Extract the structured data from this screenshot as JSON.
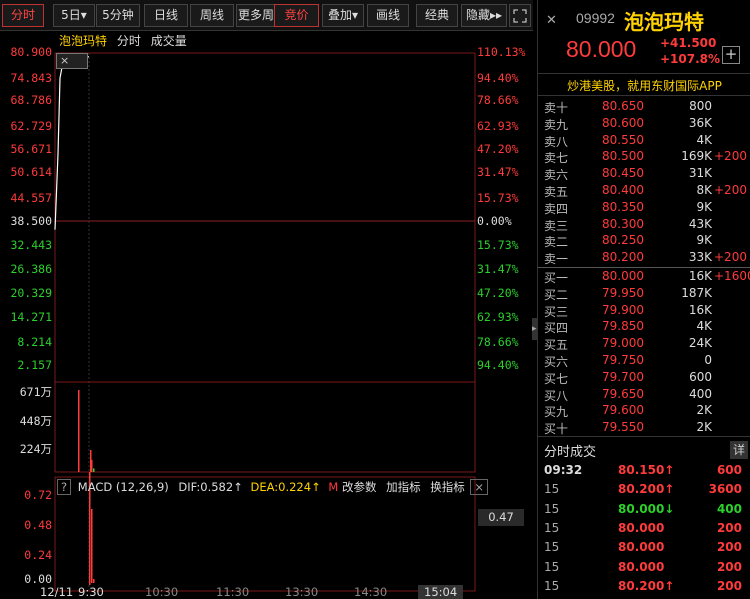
{
  "toolbar": {
    "buttons": [
      {
        "label": "分时",
        "active": true
      },
      {
        "label": "5日▾",
        "active": false
      },
      {
        "label": "5分钟",
        "active": false
      },
      {
        "label": "日线",
        "active": false
      },
      {
        "label": "周线",
        "active": false
      },
      {
        "label": "更多周",
        "active": false
      },
      {
        "label": "竞价",
        "active": true
      },
      {
        "label": "叠加▾",
        "active": false
      },
      {
        "label": "画线",
        "active": false
      },
      {
        "label": "经典",
        "active": false
      },
      {
        "label": "隐藏▸▸",
        "active": false
      }
    ],
    "fullscreen_icon": "expand-icon"
  },
  "chart_header": {
    "name": "泡泡玛特",
    "mode": "分时",
    "volume_label": "成交量"
  },
  "price_axis": {
    "left": [
      "80.900",
      "74.843",
      "68.786",
      "62.729",
      "56.671",
      "50.614",
      "44.557",
      "38.500",
      "32.443",
      "26.386",
      "20.329",
      "14.271",
      "8.214",
      "2.157"
    ],
    "right": [
      "110.13%",
      "94.40%",
      "78.66%",
      "62.93%",
      "47.20%",
      "31.47%",
      "15.73%",
      "0.00%",
      "15.73%",
      "31.47%",
      "47.20%",
      "62.93%",
      "78.66%",
      "94.40%"
    ]
  },
  "volume_axis": [
    "671万",
    "448万",
    "224万"
  ],
  "macd_header": {
    "title": "MACD (12,26,9)",
    "dif": "DIF:0.582↑",
    "dea": "DEA:0.224↑",
    "m": "M",
    "change_param": "改参数",
    "add_ind": "加指标",
    "switch_ind": "换指标"
  },
  "macd_axis": [
    "0.72",
    "0.48",
    "0.24",
    "0.00"
  ],
  "macd_value": "0.47",
  "time_axis": [
    "12/11",
    "9:30",
    "10:30",
    "11:30",
    "13:30",
    "14:30",
    "15:04"
  ],
  "chart_data": {
    "type": "line",
    "series": [
      {
        "values": [
          38.5,
          44.557,
          56.671,
          74.843,
          77.5,
          79.0,
          80.0
        ]
      }
    ],
    "volume": [
      671,
      0,
      0,
      0,
      0,
      180,
      100,
      30
    ],
    "ylim": [
      2.157,
      80.9
    ]
  },
  "quote": {
    "code": "09992",
    "name": "泡泡玛特",
    "price": "80.000",
    "change": "+41.500",
    "change_pct": "+107.8%",
    "add_icon": "plus-icon"
  },
  "ad": "炒港美股，就用东财国际APP",
  "orderbook": {
    "asks": [
      {
        "label": "卖十",
        "price": "80.650",
        "vol": "800",
        "delta": ""
      },
      {
        "label": "卖九",
        "price": "80.600",
        "vol": "36K",
        "delta": ""
      },
      {
        "label": "卖八",
        "price": "80.550",
        "vol": "4K",
        "delta": ""
      },
      {
        "label": "卖七",
        "price": "80.500",
        "vol": "169K",
        "delta": "+200"
      },
      {
        "label": "卖六",
        "price": "80.450",
        "vol": "31K",
        "delta": ""
      },
      {
        "label": "卖五",
        "price": "80.400",
        "vol": "8K",
        "delta": "+200"
      },
      {
        "label": "卖四",
        "price": "80.350",
        "vol": "9K",
        "delta": ""
      },
      {
        "label": "卖三",
        "price": "80.300",
        "vol": "43K",
        "delta": ""
      },
      {
        "label": "卖二",
        "price": "80.250",
        "vol": "9K",
        "delta": ""
      },
      {
        "label": "卖一",
        "price": "80.200",
        "vol": "33K",
        "delta": "+200"
      }
    ],
    "bids": [
      {
        "label": "买一",
        "price": "80.000",
        "vol": "16K",
        "delta": "+1600"
      },
      {
        "label": "买二",
        "price": "79.950",
        "vol": "187K",
        "delta": ""
      },
      {
        "label": "买三",
        "price": "79.900",
        "vol": "16K",
        "delta": ""
      },
      {
        "label": "买四",
        "price": "79.850",
        "vol": "4K",
        "delta": ""
      },
      {
        "label": "买五",
        "price": "79.000",
        "vol": "24K",
        "delta": ""
      },
      {
        "label": "买六",
        "price": "79.750",
        "vol": "0",
        "delta": ""
      },
      {
        "label": "买七",
        "price": "79.700",
        "vol": "600",
        "delta": ""
      },
      {
        "label": "买八",
        "price": "79.650",
        "vol": "400",
        "delta": ""
      },
      {
        "label": "买九",
        "price": "79.600",
        "vol": "2K",
        "delta": ""
      },
      {
        "label": "买十",
        "price": "79.550",
        "vol": "2K",
        "delta": ""
      }
    ]
  },
  "trades": {
    "title": "分时成交",
    "detail_button": "详",
    "rows": [
      {
        "time": "09:32",
        "price": "80.150↑",
        "vol": "600",
        "dir": "up"
      },
      {
        "time": "15",
        "price": "80.200↑",
        "vol": "3600",
        "dir": "up"
      },
      {
        "time": "15",
        "price": "80.000↓",
        "vol": "400",
        "dir": "down"
      },
      {
        "time": "15",
        "price": "80.000",
        "vol": "200",
        "dir": "flat"
      },
      {
        "time": "15",
        "price": "80.000",
        "vol": "200",
        "dir": "flat"
      },
      {
        "time": "15",
        "price": "80.000",
        "vol": "200",
        "dir": "flat"
      },
      {
        "time": "15",
        "price": "80.200↑",
        "vol": "200",
        "dir": "up"
      }
    ]
  }
}
